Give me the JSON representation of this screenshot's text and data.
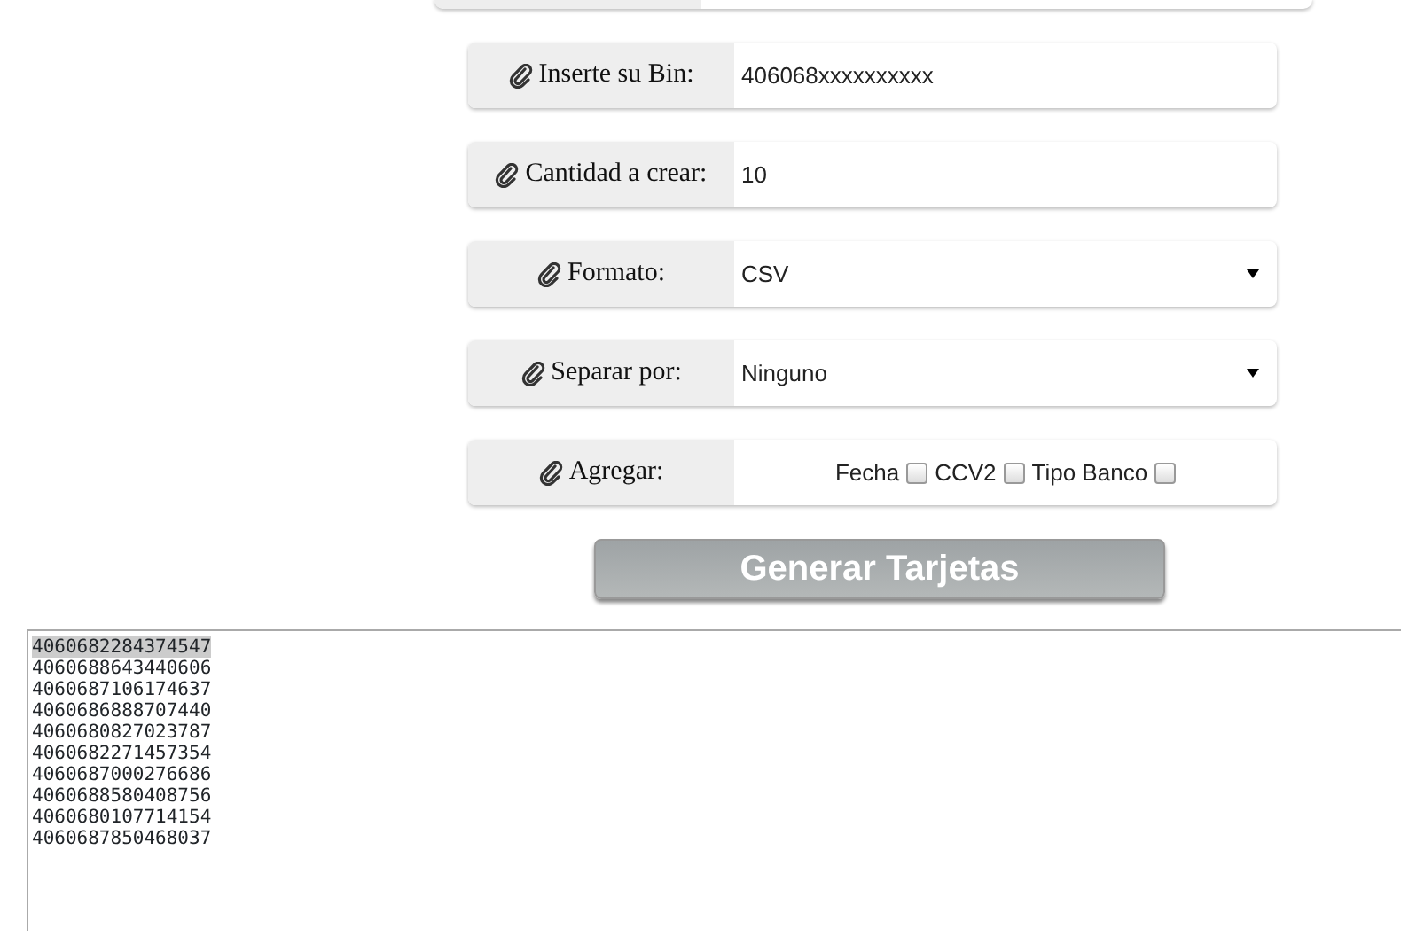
{
  "fields": [
    {
      "kind": "input",
      "label": "Inserte su Bin:",
      "value": "406068xxxxxxxxxx"
    },
    {
      "kind": "input",
      "label": "Cantidad a crear:",
      "value": "10"
    },
    {
      "kind": "select",
      "label": "Formato:",
      "value": "CSV"
    },
    {
      "kind": "select",
      "label": "Separar por:",
      "value": "Ninguno"
    },
    {
      "kind": "checks",
      "label": "Agregar:",
      "options": [
        {
          "label": "Fecha",
          "checked": false
        },
        {
          "label": "CCV2",
          "checked": false
        },
        {
          "label": "Tipo Banco",
          "checked": false
        }
      ]
    }
  ],
  "generate_button": "Generar Tarjetas",
  "output": [
    {
      "text": "4060682284374547",
      "selected": true
    },
    {
      "text": "4060688643440606",
      "selected": false
    },
    {
      "text": "4060687106174637",
      "selected": false
    },
    {
      "text": "4060686888707440",
      "selected": false
    },
    {
      "text": "4060680827023787",
      "selected": false
    },
    {
      "text": "4060682271457354",
      "selected": false
    },
    {
      "text": "4060687000276686",
      "selected": false
    },
    {
      "text": "4060688580408756",
      "selected": false
    },
    {
      "text": "4060680107714154",
      "selected": false
    },
    {
      "text": "4060687850468037",
      "selected": false
    }
  ]
}
